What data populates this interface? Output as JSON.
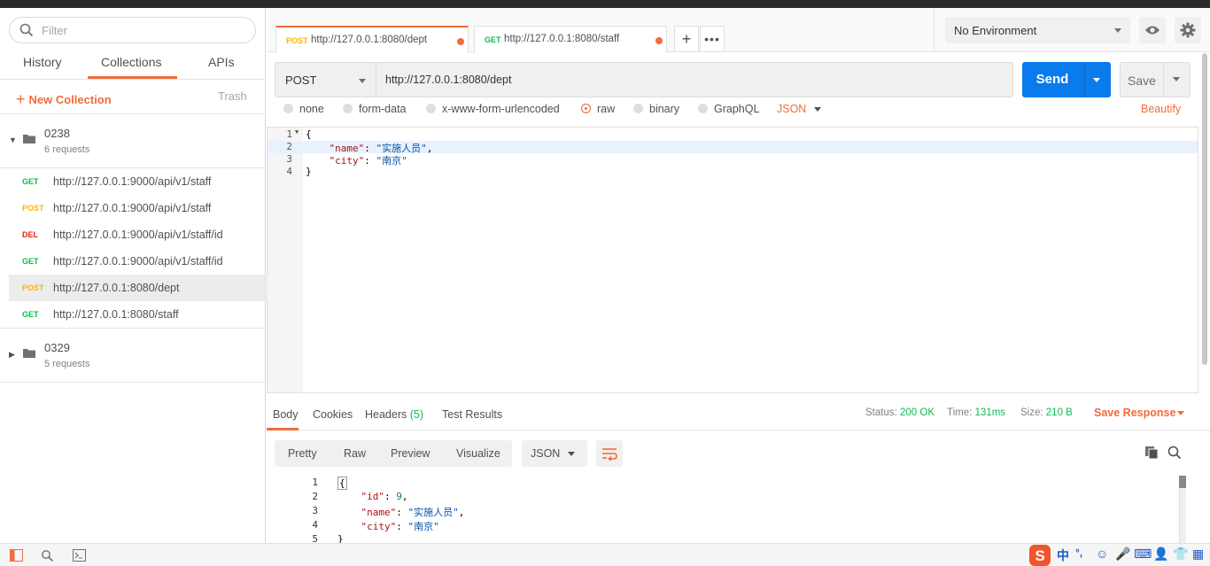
{
  "sidebar": {
    "filter_placeholder": "Filter",
    "tabs": [
      "History",
      "Collections",
      "APIs"
    ],
    "new_collection": "New Collection",
    "trash": "Trash",
    "collections": [
      {
        "name": "0238",
        "count": "6 requests",
        "requests": [
          {
            "method": "GET",
            "url": "http://127.0.0.1:9000/api/v1/staff"
          },
          {
            "method": "POST",
            "url": "http://127.0.0.1:9000/api/v1/staff"
          },
          {
            "method": "DEL",
            "url": "http://127.0.0.1:9000/api/v1/staff/id"
          },
          {
            "method": "GET",
            "url": "http://127.0.0.1:9000/api/v1/staff/id"
          },
          {
            "method": "POST",
            "url": "http://127.0.0.1:8080/dept"
          },
          {
            "method": "GET",
            "url": "http://127.0.0.1:8080/staff"
          }
        ]
      },
      {
        "name": "0329",
        "count": "5 requests"
      }
    ]
  },
  "request_tabs": [
    {
      "method": "POST",
      "url": "http://127.0.0.1:8080/dept"
    },
    {
      "method": "GET",
      "url": "http://127.0.0.1:8080/staff"
    }
  ],
  "environment": "No Environment",
  "request": {
    "method": "POST",
    "url": "http://127.0.0.1:8080/dept",
    "send": "Send",
    "save": "Save"
  },
  "body_options": {
    "none": "none",
    "form_data": "form-data",
    "urlencoded": "x-www-form-urlencoded",
    "raw": "raw",
    "binary": "binary",
    "graphql": "GraphQL",
    "format": "JSON",
    "beautify": "Beautify"
  },
  "request_body": {
    "ln": [
      "1",
      "2",
      "3",
      "4"
    ],
    "open": "{",
    "name_key": "\"name\"",
    "name_val": "\"实施人员\"",
    "city_key": "\"city\"",
    "city_val": "\"南京\"",
    "close": "}"
  },
  "response": {
    "tabs": {
      "body": "Body",
      "cookies": "Cookies",
      "headers": "Headers",
      "headers_count": "(5)",
      "tests": "Test Results"
    },
    "status_label": "Status:",
    "status": "200 OK",
    "time_label": "Time:",
    "time": "131ms",
    "size_label": "Size:",
    "size": "210 B",
    "save_response": "Save Response",
    "views": [
      "Pretty",
      "Raw",
      "Preview",
      "Visualize"
    ],
    "format": "JSON",
    "body": {
      "ln": [
        "1",
        "2",
        "3",
        "4",
        "5"
      ],
      "open": "{",
      "id_key": "\"id\"",
      "id_val": "9",
      "name_key": "\"name\"",
      "name_val": "\"实施人员\"",
      "city_key": "\"city\"",
      "city_val": "\"南京\"",
      "close": "}"
    }
  },
  "ime": {
    "lang": "中",
    "punct": "°,"
  },
  "colors": {
    "accent": "#f26b3a",
    "send": "#097bed",
    "get": "#0cbb52",
    "post": "#ffb400",
    "del": "#eb2013"
  }
}
